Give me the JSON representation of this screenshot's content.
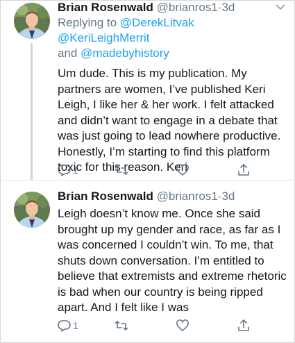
{
  "tweets": [
    {
      "author_name": "Brian Rosenwald",
      "handle": "@brianros1",
      "separator": "·",
      "time": "3d",
      "replying_prefix": "Replying to",
      "replying_mentions": [
        "@DerekLitvak",
        "@KeriLeighMerrit"
      ],
      "replying_and": "and",
      "replying_last": "@madebyhistory",
      "body_lines": [
        "Um dude. This is my publication. My",
        "partners are women, I’ve published Keri",
        "Leigh, I like her & her work. I felt attacked",
        "and didn’t want to engage in a debate that",
        "was just going to lead nowhere productive.",
        "Honestly, I’m starting to find this platform",
        "toxic for this reason. Keri"
      ],
      "reply_count": "1",
      "retweet_count": "",
      "like_count": ""
    },
    {
      "author_name": "Brian Rosenwald",
      "handle": "@brianros1",
      "separator": "·",
      "time": "3d",
      "body_lines": [
        "Leigh doesn’t know me. Once she said",
        "brought up my gender and race, as far as I",
        "was concerned I couldn’t win. To me, that",
        "shuts down conversation. I’m entitled to",
        "believe that extremists and extreme rhetoric",
        "is bad when our country is being ripped",
        "apart. And I felt like I was"
      ],
      "reply_count": "1",
      "retweet_count": "",
      "like_count": ""
    }
  ],
  "icons": {
    "reply": "reply-icon",
    "retweet": "retweet-icon",
    "like": "heart-icon",
    "share": "share-icon",
    "menu": "chevron-down-icon"
  },
  "colors": {
    "link": "#1da1f2",
    "meta": "#657786",
    "text": "#14171a",
    "thread_line": "#ccd6dd"
  }
}
